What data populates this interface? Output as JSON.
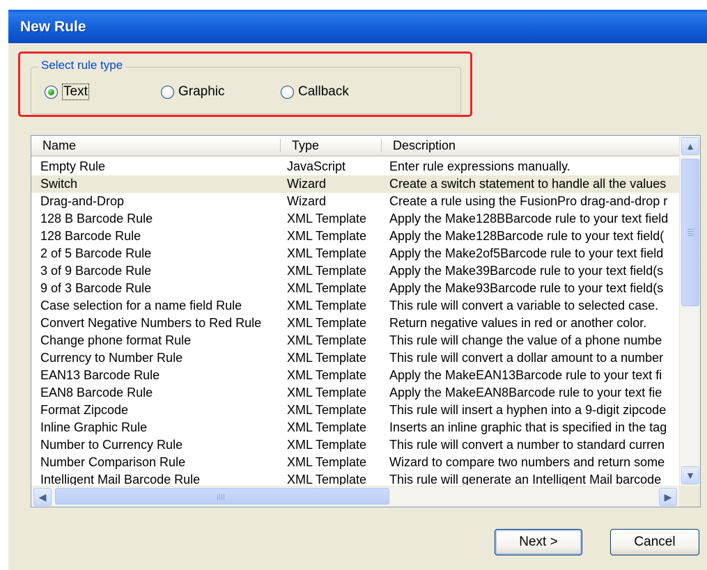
{
  "window": {
    "title": "New Rule"
  },
  "rule_type": {
    "legend": "Select rule type",
    "options": [
      {
        "label": "Text",
        "selected": true
      },
      {
        "label": "Graphic",
        "selected": false
      },
      {
        "label": "Callback",
        "selected": false
      }
    ]
  },
  "list": {
    "columns": {
      "name": "Name",
      "type": "Type",
      "description": "Description"
    },
    "selected_index": 1,
    "rows": [
      {
        "name": "Empty Rule",
        "type": "JavaScript",
        "description": "Enter rule expressions manually."
      },
      {
        "name": "Switch",
        "type": "Wizard",
        "description": "Create a switch statement to handle all the values"
      },
      {
        "name": "Drag-and-Drop",
        "type": "Wizard",
        "description": "Create a rule using the FusionPro drag-and-drop r"
      },
      {
        "name": "128 B Barcode Rule",
        "type": "XML Template",
        "description": "Apply the Make128BBarcode rule to your text field"
      },
      {
        "name": "128 Barcode Rule",
        "type": "XML Template",
        "description": "Apply the Make128Barcode rule to your text field("
      },
      {
        "name": "2 of 5 Barcode Rule",
        "type": "XML Template",
        "description": "Apply the Make2of5Barcode rule to your text field"
      },
      {
        "name": "3 of 9 Barcode Rule",
        "type": "XML Template",
        "description": "Apply the Make39Barcode rule to your text field(s"
      },
      {
        "name": "9 of 3 Barcode Rule",
        "type": "XML Template",
        "description": "Apply the Make93Barcode rule to your text field(s"
      },
      {
        "name": "Case selection for a name field Rule",
        "type": "XML Template",
        "description": "This rule will convert a variable to selected case."
      },
      {
        "name": "Convert Negative Numbers to Red Rule",
        "type": "XML Template",
        "description": "Return negative values in red or another color."
      },
      {
        "name": "Change phone format Rule",
        "type": "XML Template",
        "description": "This rule will change the value of a phone numbe"
      },
      {
        "name": "Currency to Number Rule",
        "type": "XML Template",
        "description": "This rule will convert a dollar amount to a number"
      },
      {
        "name": "EAN13 Barcode Rule",
        "type": "XML Template",
        "description": "Apply the MakeEAN13Barcode rule to your text fi"
      },
      {
        "name": "EAN8 Barcode Rule",
        "type": "XML Template",
        "description": "Apply the MakeEAN8Barcode rule to your text fie"
      },
      {
        "name": "Format Zipcode",
        "type": "XML Template",
        "description": "This rule will insert a hyphen into a 9-digit zipcode"
      },
      {
        "name": "Inline Graphic Rule",
        "type": "XML Template",
        "description": "Inserts an inline graphic that is specified in the tag"
      },
      {
        "name": "Number to Currency Rule",
        "type": "XML Template",
        "description": "This rule will convert a number to standard curren"
      },
      {
        "name": "Number Comparison Rule",
        "type": "XML Template",
        "description": "Wizard to compare two numbers and return some"
      },
      {
        "name": "Intelligent Mail Barcode Rule",
        "type": "XML Template",
        "description": "This rule will generate an Intelligent Mail barcode"
      }
    ]
  },
  "scroll_icons": {
    "up": "▲",
    "down": "▼",
    "left": "◀",
    "right": "▶"
  },
  "buttons": {
    "next": "Next >",
    "cancel": "Cancel"
  },
  "colors": {
    "title_bar": "#0b51c9",
    "highlight_border": "#e8262a",
    "legend_text": "#0046d5",
    "selected_row": "#ece9d8"
  }
}
